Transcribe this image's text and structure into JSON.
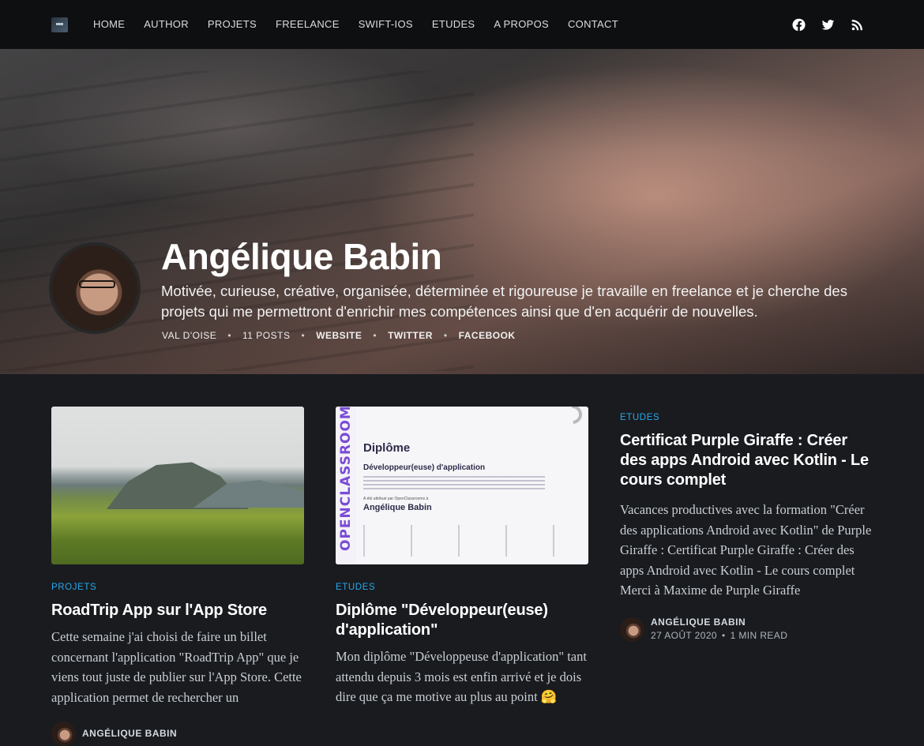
{
  "nav": {
    "logo_icon": "site-logo",
    "items": [
      {
        "label": "HOME"
      },
      {
        "label": "AUTHOR"
      },
      {
        "label": "PROJETS"
      },
      {
        "label": "FREELANCE"
      },
      {
        "label": "SWIFT-IOS"
      },
      {
        "label": "ETUDES"
      },
      {
        "label": "A PROPOS"
      },
      {
        "label": "CONTACT"
      }
    ],
    "social": [
      "facebook-icon",
      "twitter-icon",
      "rss-icon"
    ]
  },
  "profile": {
    "name": "Angélique Babin",
    "bio": "Motivée, curieuse, créative, organisée, déterminée et rigoureuse je travaille en freelance et je cherche des projets qui me permettront d'enrichir mes compétences ainsi que d'en acquérir de nouvelles.",
    "location": "VAL D'OISE",
    "posts": "11 POSTS",
    "website": "WEBSITE",
    "twitter": "TWITTER",
    "facebook": "FACEBOOK"
  },
  "posts": [
    {
      "tag": "PROJETS",
      "title": "RoadTrip App sur l'App Store",
      "excerpt": "Cette semaine j'ai choisi de faire un billet concernant l'application \"RoadTrip App\" que je viens tout juste de publier sur l'App Store. Cette application permet de rechercher un",
      "author": "ANGÉLIQUE BABIN"
    },
    {
      "tag": "ETUDES",
      "title": "Diplôme \"Développeur(euse) d'application\"",
      "excerpt": "Mon diplôme \"Développeuse d'application\" tant attendu depuis 3 mois est enfin arrivé et je dois dire que ça me motive au plus au point 🤗",
      "image": {
        "vertical_text": "OPENCLASSROOMS",
        "heading": "Diplôme",
        "subheading": "Développeur(euse) d'application",
        "attributed": "A été attribué par OpenClassrooms à",
        "recipient": "Angélique Babin"
      }
    },
    {
      "tag": "ETUDES",
      "title": "Certificat Purple Giraffe : Créer des apps Android avec Kotlin - Le cours complet",
      "excerpt": "Vacances productives avec la formation \"Créer des applications Android avec Kotlin\" de Purple Giraffe : Certificat Purple Giraffe : Créer des apps Android avec Kotlin - Le cours complet Merci à Maxime de Purple Giraffe",
      "author": "ANGÉLIQUE BABIN",
      "date": "27 AOÛT 2020",
      "read": "1 MIN READ"
    }
  ],
  "separator": "•"
}
